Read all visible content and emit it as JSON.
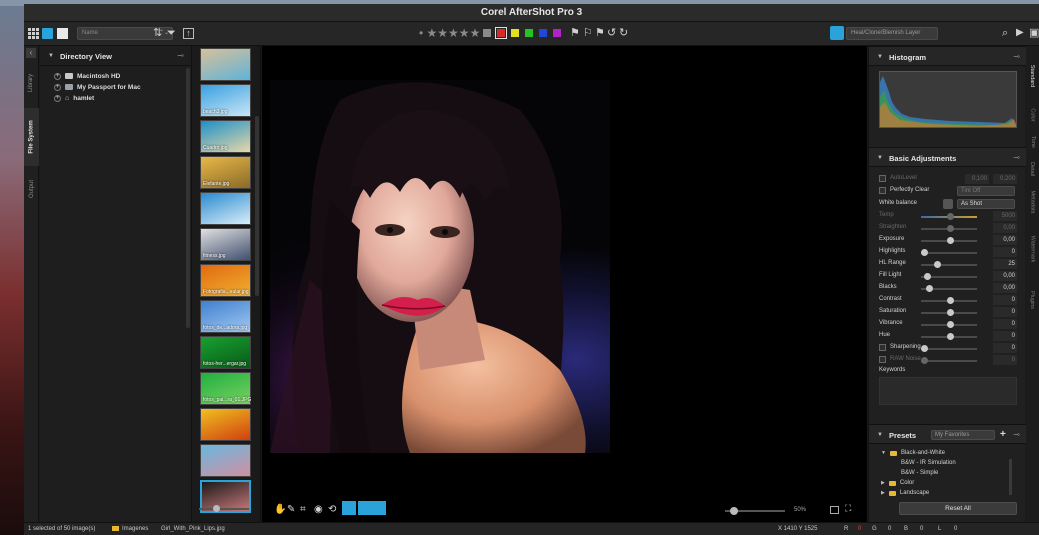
{
  "window": {
    "title": "Corel AfterShot Pro 3"
  },
  "toolbar": {
    "sort_placeholder": "Name",
    "stars": "• ★★★★★",
    "color_labels": [
      "#8a8a8a",
      "#d42a2a",
      "#e4e020",
      "#22c322",
      "#2146d8",
      "#b322c8"
    ],
    "layer_select": "Heal/Clone/Blemish Layer"
  },
  "left_tabs": [
    "Library",
    "File System",
    "Output"
  ],
  "directory": {
    "title": "Directory View",
    "items": [
      {
        "label": "Macintosh HD",
        "icon": "hard-drive-icon"
      },
      {
        "label": "My Passport for Mac",
        "icon": "external-drive-icon"
      },
      {
        "label": "hamlet",
        "icon": "home-icon"
      }
    ]
  },
  "filmstrip": {
    "thumbs": [
      {
        "label": "",
        "colors": [
          "#d8c09a",
          "#5fb3d8"
        ]
      },
      {
        "label": "beach3.jpg",
        "colors": [
          "#3aa0e0",
          "#c8e6f6"
        ]
      },
      {
        "label": "Cuadro.jpg",
        "colors": [
          "#1e90c8",
          "#e6d8a8"
        ]
      },
      {
        "label": "Elefante.jpg",
        "colors": [
          "#e8b848",
          "#8a6a28"
        ]
      },
      {
        "label": "",
        "colors": [
          "#2a8ad0",
          "#d8eef8"
        ]
      },
      {
        "label": "fitness.jpg",
        "colors": [
          "#e0e0e0",
          "#405070"
        ]
      },
      {
        "label": "Fotografia...eular.jpg",
        "colors": [
          "#e26a10",
          "#f0b030"
        ]
      },
      {
        "label": "fotos_de...adora.jpg",
        "colors": [
          "#4080d0",
          "#a0c8f0"
        ]
      },
      {
        "label": "fotos-her...ergar.jpg",
        "colors": [
          "#18a030",
          "#0a5a18"
        ]
      },
      {
        "label": "fotos_pai...ra_01.JPG",
        "colors": [
          "#20b040",
          "#7ad060"
        ]
      },
      {
        "label": "",
        "colors": [
          "#f0c020",
          "#d04010"
        ]
      },
      {
        "label": "",
        "colors": [
          "#6ab8e0",
          "#d090a0"
        ]
      },
      {
        "label": "",
        "colors": [
          "#1a1a1a",
          "#c87878"
        ]
      }
    ]
  },
  "viewer": {
    "zoom": "50%"
  },
  "histogram": {
    "title": "Histogram"
  },
  "adjustments": {
    "title": "Basic Adjustments",
    "autolevel": {
      "label": "AutoLevel",
      "v1": "0,100",
      "v2": "0,200"
    },
    "perfectly_clear": {
      "label": "Perfectly Clear",
      "select": "Tint Off"
    },
    "white_balance": {
      "label": "White balance",
      "select": "As Shot"
    },
    "sliders": [
      {
        "label": "Temp",
        "value": "5000",
        "pos": 0.5,
        "dim": true
      },
      {
        "label": "Straighten",
        "value": "0,00",
        "pos": 0.5,
        "dim": true
      },
      {
        "label": "Exposure",
        "value": "0,00",
        "pos": 0.5,
        "dim": false
      },
      {
        "label": "Highlights",
        "value": "0",
        "pos": 0.0,
        "dim": false
      },
      {
        "label": "HL Range",
        "value": "25",
        "pos": 0.25,
        "dim": false
      },
      {
        "label": "Fill Light",
        "value": "0,00",
        "pos": 0.05,
        "dim": false
      },
      {
        "label": "Blacks",
        "value": "0,00",
        "pos": 0.1,
        "dim": false
      },
      {
        "label": "Contrast",
        "value": "0",
        "pos": 0.5,
        "dim": false
      },
      {
        "label": "Saturation",
        "value": "0",
        "pos": 0.5,
        "dim": false
      },
      {
        "label": "Vibrance",
        "value": "0",
        "pos": 0.5,
        "dim": false
      },
      {
        "label": "Hue",
        "value": "0",
        "pos": 0.5,
        "dim": false
      },
      {
        "label": "Sharpening",
        "value": "0",
        "pos": 0.0,
        "dim": false
      },
      {
        "label": "RAW Noise",
        "value": "0",
        "pos": 0.0,
        "dim": true
      }
    ],
    "keywords_label": "Keywords"
  },
  "presets": {
    "title": "Presets",
    "select": "My Favorites",
    "items": [
      {
        "label": "Black-and-White",
        "folder": true,
        "expanded": true,
        "indent": 0
      },
      {
        "label": "B&W - IR Simulation",
        "folder": false,
        "indent": 1
      },
      {
        "label": "B&W - Simple",
        "folder": false,
        "indent": 1
      },
      {
        "label": "Color",
        "folder": true,
        "expanded": false,
        "indent": 0
      },
      {
        "label": "Landscape",
        "folder": true,
        "expanded": false,
        "indent": 0
      }
    ],
    "reset_label": "Reset All"
  },
  "right_tabs": [
    "Standard",
    "Color",
    "Tone",
    "Detail",
    "Metadata",
    "Watermark",
    "Plugins"
  ],
  "status": {
    "selection": "1 selected of 50 image(s)",
    "folder": "Imagenes",
    "filename": "Girl_With_Pink_Lips.jpg",
    "coords": "X 1410  Y 1525",
    "r_label": "R",
    "r_value": "0",
    "g_label": "G",
    "g_value": "0",
    "b_label": "B",
    "b_value": "0",
    "l_label": "L",
    "l_value": "0"
  }
}
